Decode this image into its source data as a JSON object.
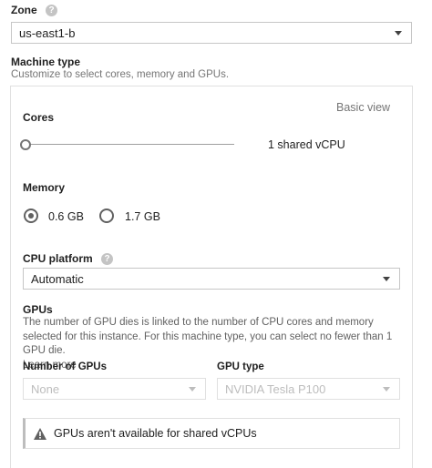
{
  "zone": {
    "label": "Zone",
    "help_icon": "help-icon",
    "selected": "us-east1-b"
  },
  "machine_type": {
    "title": "Machine type",
    "subtitle": "Customize to select cores, memory and GPUs.",
    "basic_view_link": "Basic view",
    "cores": {
      "label": "Cores",
      "value_text": "1 shared vCPU",
      "slider_fraction": 0
    },
    "memory": {
      "label": "Memory",
      "options": [
        {
          "label": "0.6 GB",
          "selected": true
        },
        {
          "label": "1.7 GB",
          "selected": false
        }
      ]
    },
    "cpu_platform": {
      "label": "CPU platform",
      "help_icon": "help-icon",
      "selected": "Automatic"
    },
    "gpus": {
      "title": "GPUs",
      "description": "The number of GPU dies is linked to the number of CPU cores and memory selected for this instance. For this machine type, you can select no fewer than 1 GPU die.",
      "learn_more": "Learn more",
      "number_label": "Number of GPUs",
      "number_value": "None",
      "type_label": "GPU type",
      "type_value": "NVIDIA Tesla P100",
      "warning_icon": "warning-icon",
      "warning": "GPUs aren't available for shared vCPUs"
    }
  }
}
